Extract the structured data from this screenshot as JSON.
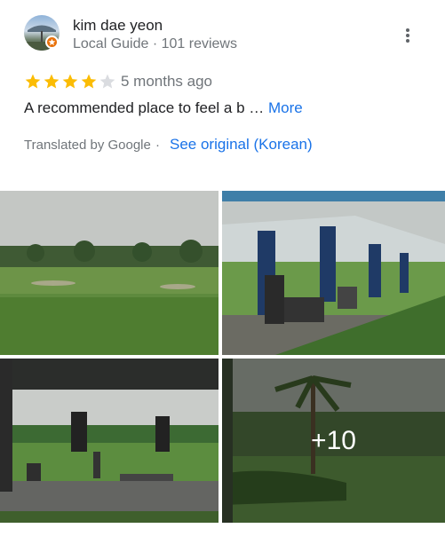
{
  "reviewer": {
    "name": "kim dae yeon",
    "subline": "Local Guide · 101 reviews"
  },
  "rating": {
    "stars": 4,
    "max": 5
  },
  "time": "5 months ago",
  "review": {
    "text": "A recommended place to feel a b …",
    "more_label": "More"
  },
  "translation": {
    "note": "Translated by Google",
    "separator": "·",
    "link": "See original (Korean)"
  },
  "photos": {
    "more_count_label": "+10"
  },
  "colors": {
    "star_filled": "#fbbc04",
    "star_empty": "#dadce0",
    "link": "#1a73e8",
    "badge": "#e8710a"
  },
  "icons": {
    "menu": "more-vert-icon",
    "badge": "local-guide-star-icon"
  }
}
